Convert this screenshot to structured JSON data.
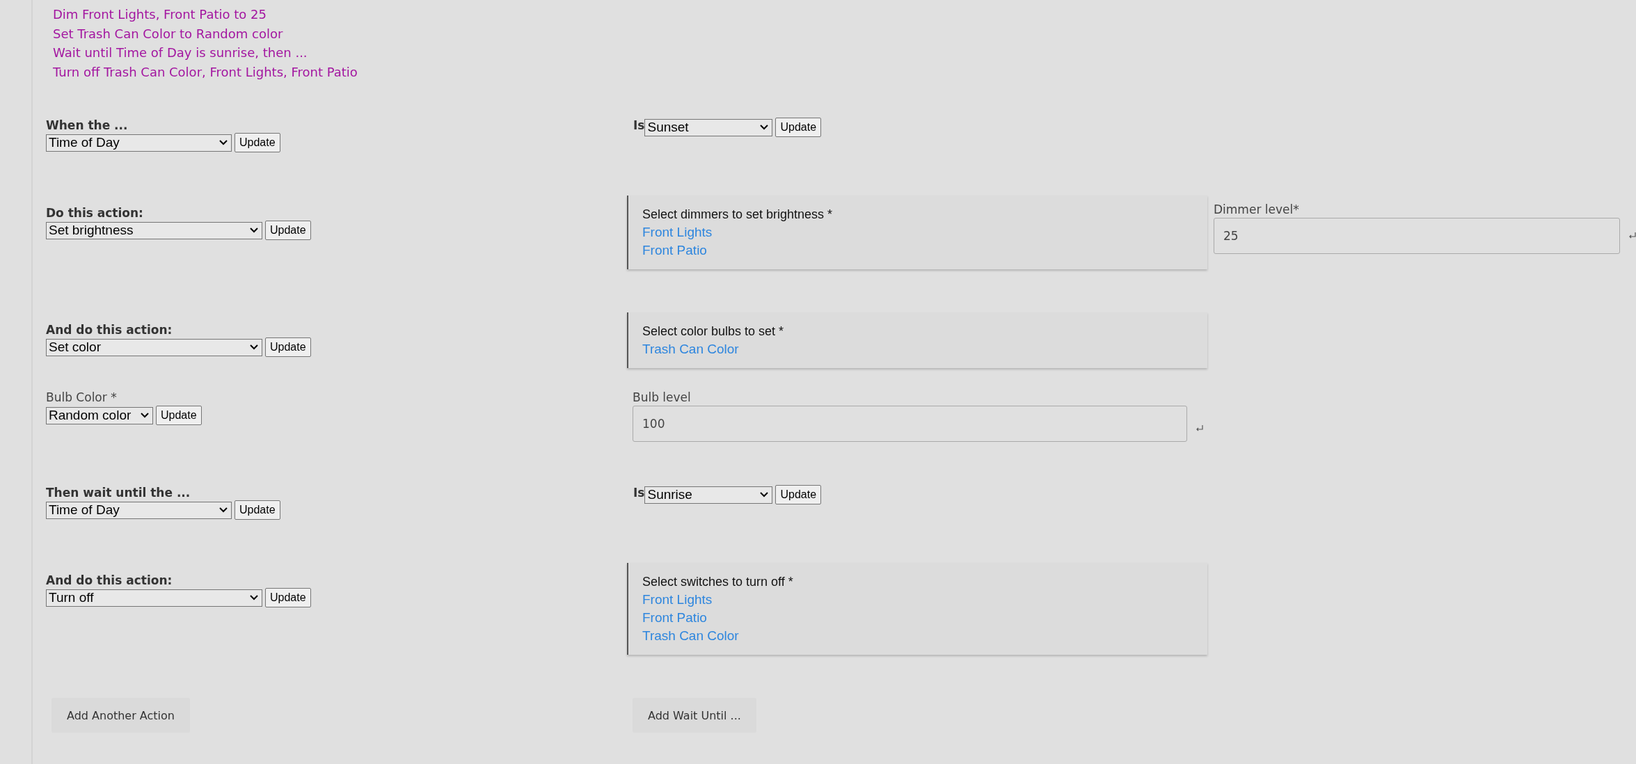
{
  "summary": [
    "Dim Front Lights, Front Patio to 25",
    "Set Trash Can Color to Random color",
    "Wait until Time of Day is sunrise, then ...",
    "Turn off Trash Can Color, Front Lights, Front Patio"
  ],
  "sections": [
    {
      "kind": "trigger",
      "label": "When the ...",
      "select": "Time of Day",
      "button": "Update",
      "is_label": "Is",
      "is_select": "Sunset",
      "is_button": "Update"
    },
    {
      "kind": "action",
      "label": "Do this action:",
      "select": "Set brightness",
      "button": "Update",
      "picker": {
        "title": "Select dimmers to set brightness *",
        "items": [
          "Front Lights",
          "Front Patio"
        ]
      },
      "field": {
        "label": "Dimmer level*",
        "value": "25"
      }
    },
    {
      "kind": "action",
      "label": "And do this action:",
      "select": "Set color",
      "button": "Update",
      "picker": {
        "title": "Select color bulbs to set *",
        "items": [
          "Trash Can Color"
        ]
      }
    },
    {
      "kind": "options",
      "label": "Bulb Color *",
      "select": "Random color",
      "button": "Update",
      "field": {
        "label": "Bulb level",
        "value": "100"
      }
    },
    {
      "kind": "trigger",
      "label": "Then wait until the ...",
      "select": "Time of Day",
      "button": "Update",
      "is_label": "Is",
      "is_select": "Sunrise",
      "is_button": "Update"
    },
    {
      "kind": "action",
      "label": "And do this action:",
      "select": "Turn off",
      "button": "Update",
      "picker": {
        "title": "Select switches to turn off *",
        "items": [
          "Front Lights",
          "Front Patio",
          "Trash Can Color"
        ]
      }
    }
  ],
  "buttons": [
    "Add Another Action",
    "Add Wait Until ..."
  ]
}
